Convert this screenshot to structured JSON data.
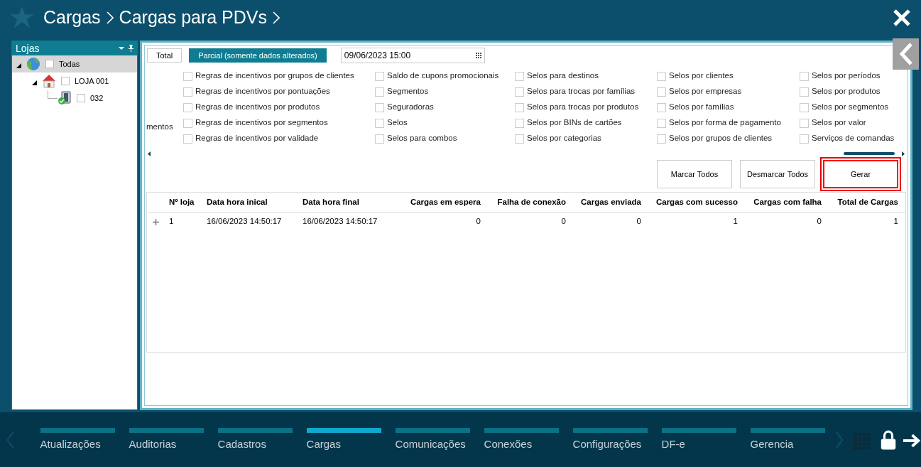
{
  "header": {
    "breadcrumbs": [
      "Cargas",
      "Cargas para PDVs"
    ]
  },
  "sidebar": {
    "title": "Lojas",
    "tree": [
      {
        "label": "Todas",
        "kind": "globe",
        "checked": false,
        "selected": true,
        "expanded": true,
        "children": [
          {
            "label": "LOJA 001",
            "kind": "store",
            "checked": false,
            "selected": false,
            "expanded": true,
            "children": [
              {
                "label": "032",
                "kind": "terminal",
                "checked": false,
                "selected": false
              }
            ]
          }
        ]
      }
    ]
  },
  "mode_tabs": [
    {
      "label": "Total",
      "selected": false
    },
    {
      "label": "Parcial (somente dados alterados)",
      "selected": true
    }
  ],
  "date_field": {
    "value": "09/06/2023 15:00"
  },
  "clipped_label": "mentos",
  "checkbox_columns": [
    [
      {
        "label": "Regras de incentivos por grupos de clientes",
        "checked": false
      },
      {
        "label": "Regras de incentivos por pontuações",
        "checked": false
      },
      {
        "label": "Regras de incentivos por produtos",
        "checked": false
      },
      {
        "label": "Regras de incentivos por segmentos",
        "checked": false
      },
      {
        "label": "Regras de incentivos por validade",
        "checked": false
      }
    ],
    [
      {
        "label": "Saldo de cupons promocionais",
        "checked": false
      },
      {
        "label": "Segmentos",
        "checked": false
      },
      {
        "label": "Seguradoras",
        "checked": false
      },
      {
        "label": "Selos",
        "checked": false
      },
      {
        "label": "Selos para combos",
        "checked": false
      }
    ],
    [
      {
        "label": "Selos para destinos",
        "checked": false
      },
      {
        "label": "Selos para trocas por famílias",
        "checked": false
      },
      {
        "label": "Selos para trocas por produtos",
        "checked": false
      },
      {
        "label": "Selos por BINs de cartões",
        "checked": false
      },
      {
        "label": "Selos por categorias",
        "checked": false
      }
    ],
    [
      {
        "label": "Selos por clientes",
        "checked": false
      },
      {
        "label": "Selos por empresas",
        "checked": false
      },
      {
        "label": "Selos por famílias",
        "checked": false
      },
      {
        "label": "Selos por forma de pagamento",
        "checked": false
      },
      {
        "label": "Selos por grupos de clientes",
        "checked": false
      }
    ],
    [
      {
        "label": "Selos por períodos",
        "checked": false
      },
      {
        "label": "Selos por produtos",
        "checked": false
      },
      {
        "label": "Selos por segmentos",
        "checked": false
      },
      {
        "label": "Selos por valor",
        "checked": false
      },
      {
        "label": "Serviços de comandas",
        "checked": false
      }
    ]
  ],
  "buttons": [
    {
      "label": "Marcar Todos",
      "highlighted": false
    },
    {
      "label": "Desmarcar Todos",
      "highlighted": false
    },
    {
      "label": "Gerar",
      "highlighted": true
    }
  ],
  "table": {
    "columns": [
      "Nº loja",
      "Data hora inical",
      "Data hora final",
      "Cargas em espera",
      "Falha de conexão",
      "Cargas enviada",
      "Cargas com sucesso",
      "Cargas com falha",
      "Total de Cargas"
    ],
    "rows": [
      {
        "expanded": false,
        "cells": [
          "1",
          "16/06/2023 14:50:17",
          "16/06/2023 14:50:17",
          "0",
          "0",
          "0",
          "1",
          "0",
          "1"
        ]
      }
    ]
  },
  "bottom_nav": [
    {
      "label": "Atualizações",
      "selected": false
    },
    {
      "label": "Auditorias",
      "selected": false
    },
    {
      "label": "Cadastros",
      "selected": false
    },
    {
      "label": "Cargas",
      "selected": true
    },
    {
      "label": "Comunicações",
      "selected": false
    },
    {
      "label": "Conexões",
      "selected": false
    },
    {
      "label": "Configurações",
      "selected": false
    },
    {
      "label": "DF-e",
      "selected": false
    },
    {
      "label": "Gerencia",
      "selected": false
    }
  ]
}
